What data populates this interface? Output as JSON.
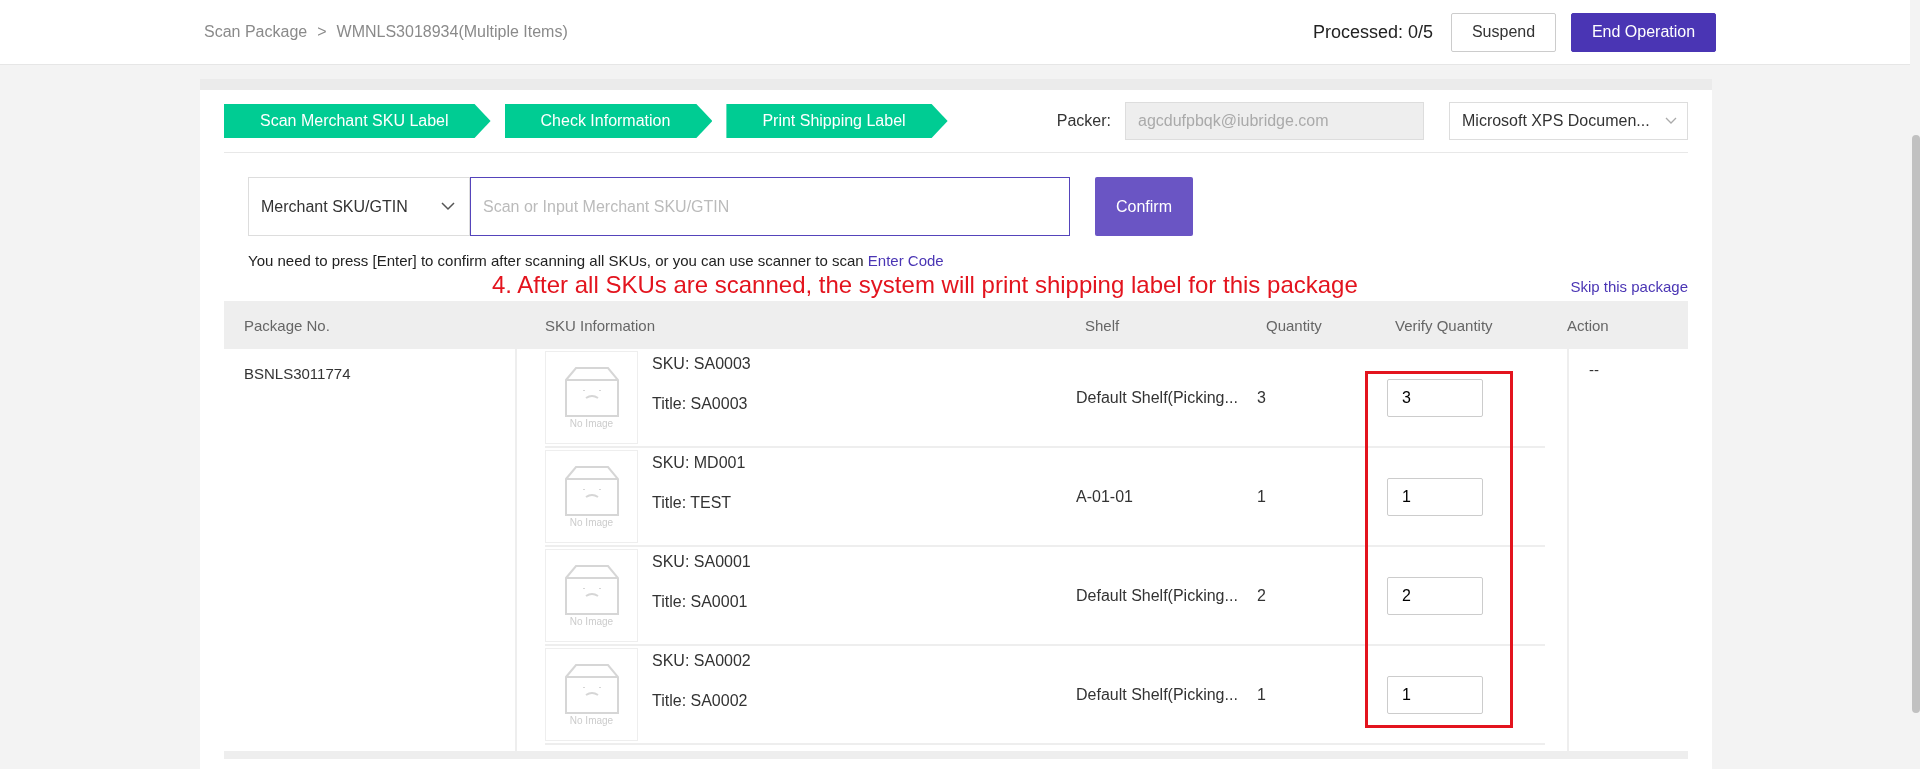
{
  "breadcrumb": {
    "items": [
      "Scan Package",
      "WMNLS3018934(Multiple Items)"
    ],
    "separator": ">"
  },
  "header": {
    "processed": "Processed: 0/5",
    "buttons": [
      {
        "label": "Suspend",
        "kind": "secondary"
      },
      {
        "label": "End Operation",
        "kind": "primary"
      }
    ]
  },
  "steps": [
    {
      "label": "Scan Merchant SKU Label"
    },
    {
      "label": "Check Information"
    },
    {
      "label": "Print Shipping Label"
    }
  ],
  "packer": {
    "label": "Packer:",
    "value": "agcdufpbqk@iubridge.com",
    "disabled": true
  },
  "printer": {
    "value": "Microsoft XPS Documen..."
  },
  "scan": {
    "type": "Merchant SKU/GTIN",
    "placeholder": "Scan or Input Merchant SKU/GTIN",
    "button": "Confirm"
  },
  "hint": {
    "text": "You need to press [Enter] to confirm after scanning all SKUs, or you can use scanner to scan",
    "link": "Enter Code"
  },
  "annotation": "4. After all SKUs are scanned, the system will print shipping label for this package",
  "skip_link": "Skip this package",
  "table": {
    "columns": [
      "Package No.",
      "SKU Information",
      "Shelf",
      "Quantity",
      "Verify Quantity",
      "Action"
    ],
    "package_no": "BSNLS3011774",
    "action": "--",
    "items": [
      {
        "image": "No Image",
        "sku": "SKU: SA0003",
        "title": "Title: SA0003",
        "shelf": "Default Shelf(Picking...",
        "quantity": "3",
        "verify": "3"
      },
      {
        "image": "No Image",
        "sku": "SKU: MD001",
        "title": "Title: TEST",
        "shelf": "A-01-01",
        "quantity": "1",
        "verify": "1"
      },
      {
        "image": "No Image",
        "sku": "SKU: SA0001",
        "title": "Title: SA0001",
        "shelf": "Default Shelf(Picking...",
        "quantity": "2",
        "verify": "2"
      },
      {
        "image": "No Image",
        "sku": "SKU: SA0002",
        "title": "Title: SA0002",
        "shelf": "Default Shelf(Picking...",
        "quantity": "1",
        "verify": "1"
      }
    ]
  }
}
